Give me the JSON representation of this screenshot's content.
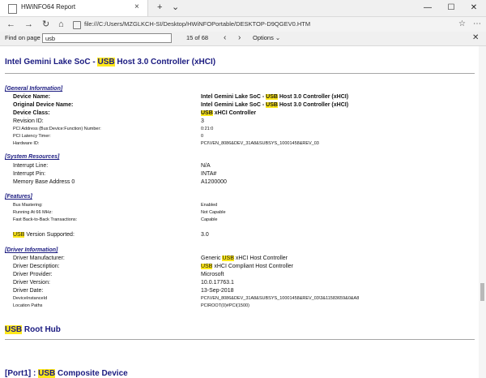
{
  "window": {
    "tab_title": "HWiNFO64 Report",
    "new_tab": "+",
    "tab_close": "×",
    "tab_menu": "⌄",
    "minimize": "—",
    "maximize": "☐",
    "close": "✕"
  },
  "address": {
    "back": "←",
    "forward": "→",
    "refresh": "↻",
    "home": "⌂",
    "url": "file:///C:/Users/MZGLKCH-SI/Desktop/HWiNFOPortable/DESKTOP-D9QGEV0.HTM",
    "favorites": "☆",
    "menu": "⋯"
  },
  "find": {
    "label": "Find on page",
    "query": "usb",
    "count": "15 of 68",
    "prev": "‹",
    "next": "›",
    "options": "Options ⌄",
    "close": "✕"
  },
  "report": {
    "device_title_pre": "Intel Gemini Lake SoC - ",
    "device_title_hl": "USB",
    "device_title_post": " Host 3.0 Controller (xHCI)",
    "general_info": "[General Information]",
    "general": [
      {
        "label": "Device Name:",
        "value_pre": "Intel Gemini Lake SoC - ",
        "value_hl": "USB",
        "value_post": " Host 3.0 Controller (xHCI)"
      },
      {
        "label": "Original Device Name:",
        "value_pre": "Intel Gemini Lake SoC - ",
        "value_hl": "USB",
        "value_post": " Host 3.0 Controller (xHCI)"
      },
      {
        "label": "Device Class:",
        "value_pre": "",
        "value_hl": "USB",
        "value_post": " xHCI Controller"
      },
      {
        "label": "Revision ID:",
        "value": "3"
      },
      {
        "label": "PCI Address (Bus:Device:Function) Number:",
        "value": "0:21:0"
      },
      {
        "label": "PCI Latency Timer:",
        "value": "0"
      },
      {
        "label": "Hardware ID:",
        "value": "PCI\\VEN_8086&DEV_31A8&SUBSYS_10001458&REV_03"
      }
    ],
    "system_resources": "[System Resources]",
    "resources": [
      {
        "label": "Interrupt Line:",
        "value": "N/A"
      },
      {
        "label": "Interrupt Pin:",
        "value": "INTA#"
      },
      {
        "label": "Memory Base Address 0",
        "value": "A1200000"
      }
    ],
    "features_title": "[Features]",
    "features": [
      {
        "label": "Bus Mastering:",
        "value": "Enabled"
      },
      {
        "label": "Running At 66 MHz:",
        "value": "Not Capable"
      },
      {
        "label": "Fast Back-to-Back Transactions:",
        "value": "Capable"
      }
    ],
    "usb_version_hl": "USB",
    "usb_version_label": " Version Supported:",
    "usb_version_value": "3.0",
    "driver_info": "[Driver Information]",
    "driver": [
      {
        "label": "Driver Manufacturer:",
        "value_pre": "Generic ",
        "value_hl": "USB",
        "value_post": " xHCI Host Controller"
      },
      {
        "label": "Driver Description:",
        "value_pre": "",
        "value_hl": "USB",
        "value_post": " xHCI Compliant Host Controller"
      },
      {
        "label": "Driver Provider:",
        "value": "Microsoft"
      },
      {
        "label": "Driver Version:",
        "value": "10.0.17763.1"
      },
      {
        "label": "Driver Date:",
        "value": "13-Sep-2018"
      },
      {
        "label": "DeviceInstanceId",
        "value": "PCI\\VEN_8086&DEV_31A8&SUBSYS_10001458&REV_03\\3&11583659&0&A8"
      },
      {
        "label": "Location Paths",
        "value": "PCIROOT(0)#PCI(1500)"
      }
    ],
    "root_hub_hl": "USB",
    "root_hub_post": " Root Hub",
    "port_pre": "[Port1] : ",
    "port_hl": "USB",
    "port_post": " Composite Device"
  },
  "colors": {
    "heading": "#1a1a80",
    "highlight": "#ffe81a"
  }
}
